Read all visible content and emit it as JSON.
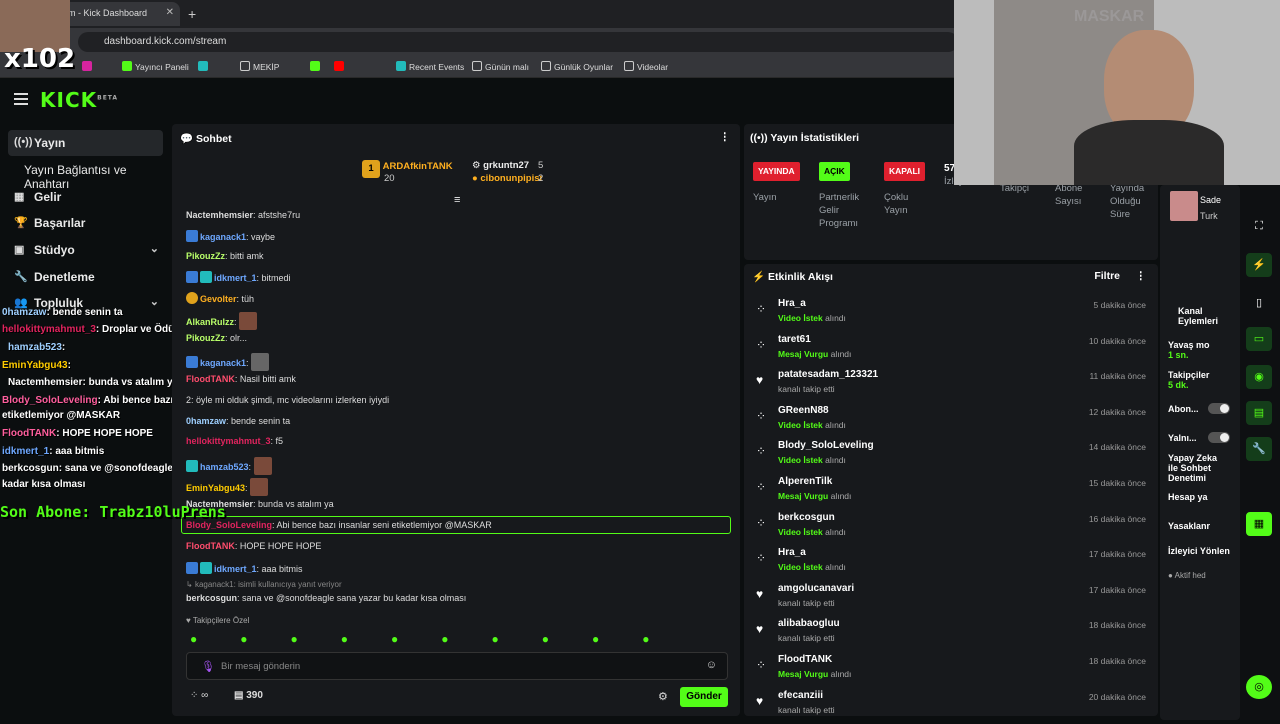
{
  "browser": {
    "tab_title": "m - Kick Dashboard",
    "tab_close": "✕",
    "new_tab": "+",
    "url": "dashboard.kick.com/stream",
    "bookmarks": [
      "Yayıncı Paneli",
      "MEKİP",
      "Recent Events",
      "Günün malı",
      "Günlük Oyunlar",
      "Videolar"
    ]
  },
  "overlay": {
    "counter": "x102",
    "sub_banner": "Son Abone: Trabz10luPrens",
    "chat": [
      {
        "user": "0hamzaw",
        "text": ": bende senin ta",
        "color": "#9fd0ff"
      },
      {
        "user": "hellokittymahmut_3",
        "text": ": Droplar ve Ödüller",
        "color": "#e0245e"
      },
      {
        "user": "hamzab523",
        "text": ":",
        "color": "#9fd0ff"
      },
      {
        "user": "EminYabgu43",
        "text": ":",
        "color": "#ffcc00"
      },
      {
        "user": "Nactemhemsier",
        "text": ": bunda vs atalım ya",
        "color": "#ffffff"
      },
      {
        "user": "Blody_SoloLeveling",
        "text": ": Abi bence bazı insanlar seni",
        "color": "#ff5f9e"
      },
      {
        "user": "",
        "text": "etiketlemiyor @MASKAR",
        "color": "#ffffff"
      },
      {
        "user": "FloodTANK",
        "text": ": HOPE HOPE HOPE",
        "color": "#ff5f9e"
      },
      {
        "user": "idkmert_1",
        "text": ": aaa bitmis",
        "color": "#6ea8ff"
      },
      {
        "user": "berkcosgun",
        "text": ": sana ve @sonofdeagle sana yazar bu",
        "color": "#ffffff"
      },
      {
        "user": "",
        "text": "kadar kısa olması",
        "color": "#ffffff"
      }
    ]
  },
  "sidebar": {
    "items": [
      {
        "label": "Yayın",
        "icon": "broadcast-icon"
      },
      {
        "label": "Yayın Bağlantısı ve Anahtarı",
        "icon": ""
      },
      {
        "label": "Gelir",
        "icon": "revenue-icon"
      },
      {
        "label": "Başarılar",
        "icon": "trophy-icon"
      },
      {
        "label": "Stüdyo",
        "icon": "studio-icon"
      },
      {
        "label": "Denetleme",
        "icon": "wrench-icon"
      },
      {
        "label": "Topluluk",
        "icon": "community-icon"
      }
    ]
  },
  "chat": {
    "title": "Sohbet",
    "leaderboard": {
      "first": {
        "rank": "1",
        "name": "ARDAfkinTANK",
        "score": "20"
      },
      "second": {
        "name": "grkuntn27",
        "score": "5"
      },
      "third": {
        "name": "cibonunpipisi",
        "score": "2"
      }
    },
    "messages": [
      {
        "user": "Nactemhemsier",
        "text": ": afstshe7ru",
        "color": "#ffffff"
      },
      {
        "user": "kaganack1",
        "text": ": vaybe",
        "color": "#6ea8ff"
      },
      {
        "user": "PikouzZz",
        "text": ": bitti amk",
        "color": "#b9ff6a"
      },
      {
        "user": "idkmert_1",
        "text": ": bitmedi",
        "color": "#6ea8ff"
      },
      {
        "user": "Gevolter",
        "text": ": tüh",
        "color": "#ffb020"
      },
      {
        "user": "AlkanRulzz",
        "text": ":",
        "color": "#b9ff6a"
      },
      {
        "user": "PikouzZz",
        "text": ": olr...",
        "color": "#b9ff6a"
      },
      {
        "user": "kaganack1",
        "text": ":",
        "color": "#6ea8ff"
      },
      {
        "user": "FloodTANK",
        "text": ": Nasil bitti amk",
        "color": "#ff4d6d"
      },
      {
        "user": "",
        "text": "2: öyle mi olduk şimdi, mc videolarını izlerken iyiydi",
        "color": "#ffffff"
      },
      {
        "user": "0hamzaw",
        "text": ": bende senin ta",
        "color": "#9fd0ff"
      },
      {
        "user": "hellokittymahmut_3",
        "text": ": f5",
        "color": "#e0245e"
      },
      {
        "user": "hamzab523",
        "text": ":",
        "color": "#6ea8ff"
      },
      {
        "user": "EminYabgu43",
        "text": ":",
        "color": "#ffcc00"
      },
      {
        "user": "Nactemhemsier",
        "text": ": bunda vs atalım ya",
        "color": "#ffffff"
      },
      {
        "user": "Blody_SoloLeveling",
        "text": ": Abi bence bazı insanlar seni etiketlemiyor @MASKAR",
        "color": "#e0245e"
      },
      {
        "user": "FloodTANK",
        "text": ": HOPE HOPE HOPE",
        "color": "#ff4d6d"
      },
      {
        "user": "idkmert_1",
        "text": ": aaa bitmis",
        "color": "#6ea8ff"
      },
      {
        "user": "kaganack1",
        "text": ": isimli kullanıcıya yanıt veriyor",
        "color": "#888888"
      },
      {
        "user": "berkcosgun",
        "text": ": sana ve @sonofdeagle sana yazar bu kadar kısa olması",
        "color": "#ffffff"
      }
    ],
    "followers_label": "Takipçilere Özel",
    "input_placeholder": "Bir mesaj gönderin",
    "points": "390",
    "send": "Gönder"
  },
  "stats": {
    "title": "Yayın İstatistikleri",
    "items": [
      {
        "pill": "YAYINDA",
        "pill_color": "#e0202e",
        "label": "Yayın"
      },
      {
        "pill": "AÇIK",
        "pill_color": "#53fc18",
        "label": "Partnerlik Gelir Programı"
      },
      {
        "pill": "KAPALI",
        "pill_color": "#e0202e",
        "label": "Çoklu Yayın"
      },
      {
        "value": "57",
        "label": "İzleyici"
      },
      {
        "label": "Takipçi"
      },
      {
        "label": "Abone Sayısı"
      },
      {
        "label": "Yayında Olduğu Süre"
      }
    ]
  },
  "feed": {
    "title": "Etkinlik Akışı",
    "filter": "Filtre",
    "items": [
      {
        "name": "Hra_a",
        "hl": "Video İstek",
        "rest": " alındı",
        "time": "5 dakika önce",
        "icon": "user-icon"
      },
      {
        "name": "taret61",
        "hl": "Mesaj Vurgu",
        "rest": " alındı",
        "time": "10 dakika önce",
        "icon": "user-icon"
      },
      {
        "name": "patatesadam_123321",
        "hl": "",
        "rest": "kanalı takip etti",
        "time": "11 dakika önce",
        "icon": "heart-icon"
      },
      {
        "name": "GReenN88",
        "hl": "Video İstek",
        "rest": " alındı",
        "time": "12 dakika önce",
        "icon": "user-icon"
      },
      {
        "name": "Blody_SoloLeveling",
        "hl": "Video İstek",
        "rest": " alındı",
        "time": "14 dakika önce",
        "icon": "user-icon"
      },
      {
        "name": "AlperenTilk",
        "hl": "Mesaj Vurgu",
        "rest": " alındı",
        "time": "15 dakika önce",
        "icon": "user-icon"
      },
      {
        "name": "berkcosgun",
        "hl": "Video İstek",
        "rest": " alındı",
        "time": "16 dakika önce",
        "icon": "user-icon"
      },
      {
        "name": "Hra_a",
        "hl": "Video İstek",
        "rest": " alındı",
        "time": "17 dakika önce",
        "icon": "user-icon"
      },
      {
        "name": "amgolucanavari",
        "hl": "",
        "rest": "kanalı takip etti",
        "time": "17 dakika önce",
        "icon": "heart-icon"
      },
      {
        "name": "alibabaogluu",
        "hl": "",
        "rest": "kanalı takip etti",
        "time": "18 dakika önce",
        "icon": "heart-icon"
      },
      {
        "name": "FloodTANK",
        "hl": "Mesaj Vurgu",
        "rest": " alındı",
        "time": "18 dakika önce",
        "icon": "user-icon"
      },
      {
        "name": "efecanziii",
        "hl": "",
        "rest": "kanalı takip etti",
        "time": "20 dakika önce",
        "icon": "heart-icon"
      }
    ]
  },
  "channel_actions": {
    "title": "Kanal Eylemleri",
    "slow_mode": "Yavaş mo",
    "slow_sub": "1 sn.",
    "followers": "Takipçiler",
    "followers_sub": "5 dk.",
    "subs": "Abon...",
    "only": "Yalnı...",
    "ai": "Yapay Zeka ile Sohbet Denetimi",
    "account_age": "Hesap ya",
    "bans": "Yasaklanr",
    "viewer_redirect": "İzleyici Yönlen",
    "active": "Aktif hed",
    "side_card": "Sade",
    "side_card2": "Turk"
  },
  "webcam_text": "MASKAR"
}
